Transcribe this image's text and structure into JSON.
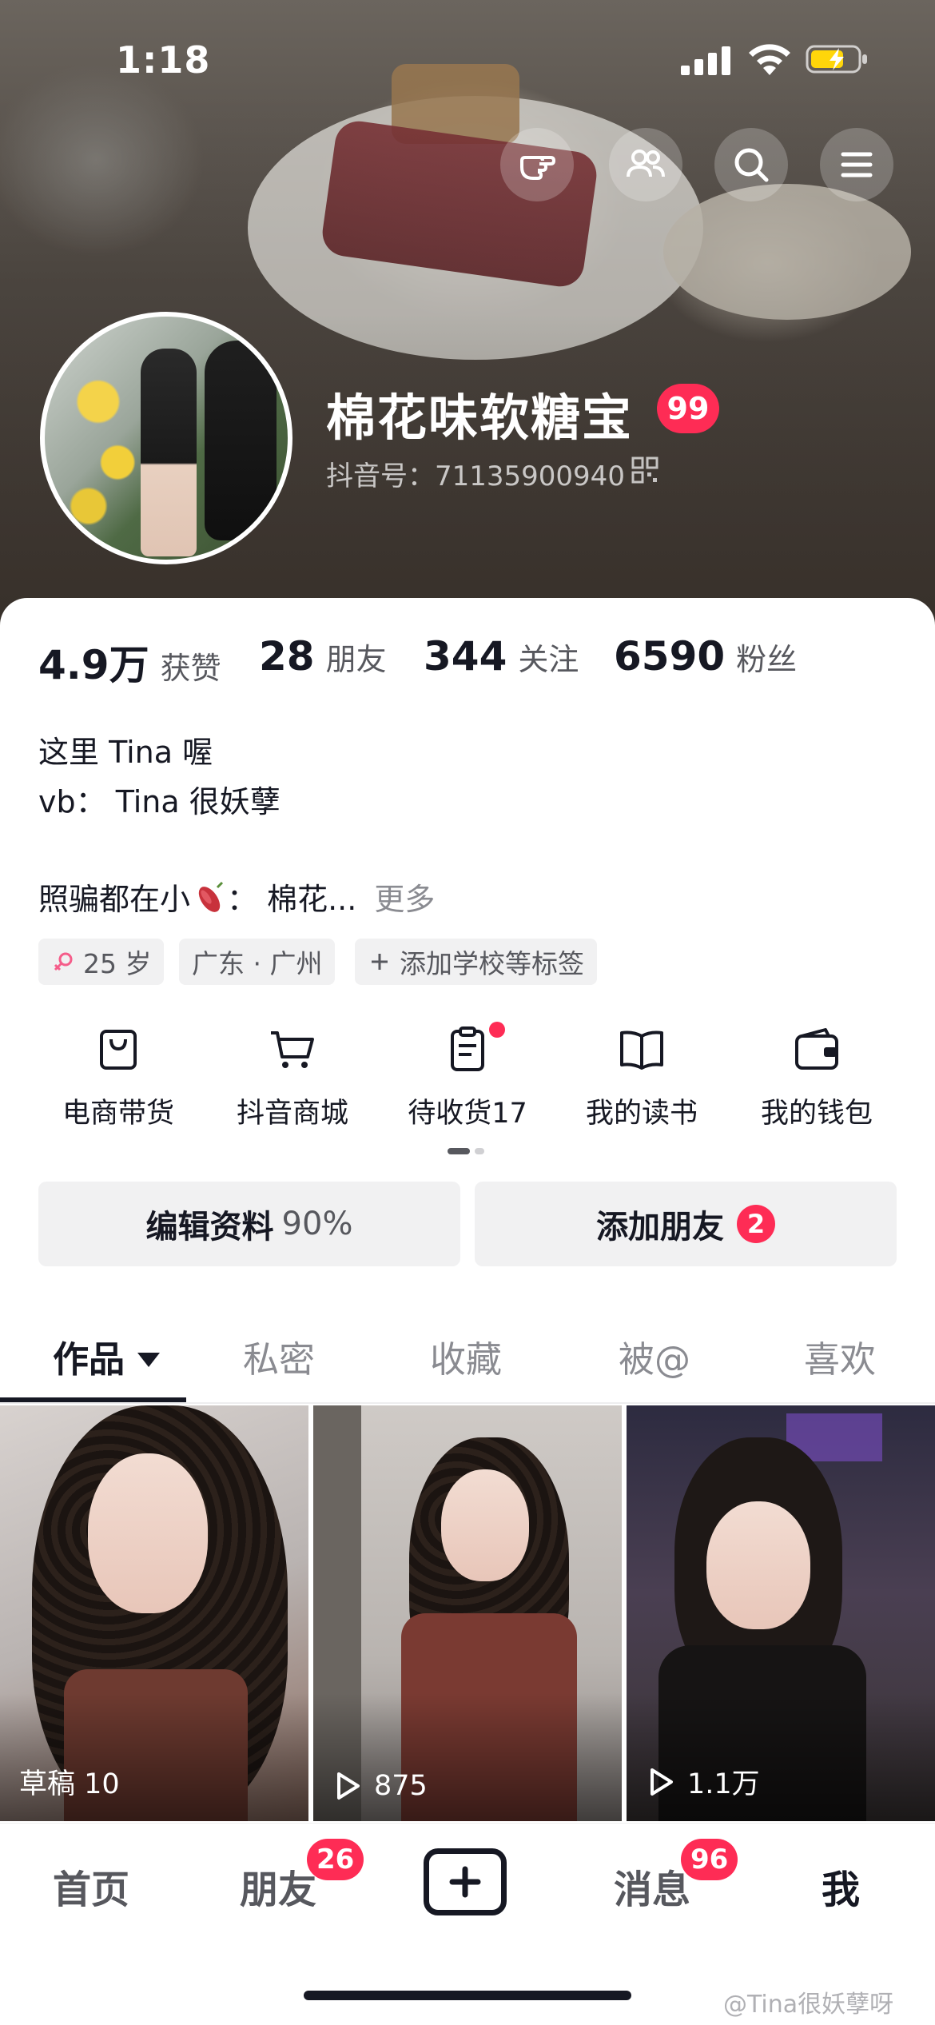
{
  "status_bar": {
    "time": "1:18"
  },
  "profile": {
    "nickname": "棉花味软糖宝",
    "level_badge": "99",
    "douyin_id": "抖音号：71135900940"
  },
  "stats": [
    {
      "value": "4.9万",
      "label": "获赞"
    },
    {
      "value": "28",
      "label": "朋友"
    },
    {
      "value": "344",
      "label": "关注"
    },
    {
      "value": "6590",
      "label": "粉丝"
    }
  ],
  "bio": {
    "line1": "这里 Tina 喔",
    "line2": "vb：  Tina 很妖孽",
    "line3_prefix": "照骗都在小",
    "line3_suffix": "：  棉花...",
    "more": "更多"
  },
  "tags": {
    "age": "25 岁",
    "location": "广东 · 广州",
    "add_school": "添加学校等标签"
  },
  "services": [
    {
      "label": "电商带货",
      "icon": "bag-icon"
    },
    {
      "label": "抖音商城",
      "icon": "cart-icon"
    },
    {
      "label": "待收货17",
      "icon": "clipboard-icon"
    },
    {
      "label": "我的读书",
      "icon": "book-icon"
    },
    {
      "label": "我的钱包",
      "icon": "wallet-icon"
    }
  ],
  "actions": {
    "edit_profile": "编辑资料",
    "edit_percent": "90%",
    "add_friend": "添加朋友",
    "add_friend_badge": "2"
  },
  "tabs": [
    "作品",
    "私密",
    "收藏",
    "被@",
    "喜欢"
  ],
  "videos": [
    {
      "caption": "草稿 10",
      "type": "draft"
    },
    {
      "caption": "875",
      "type": "play"
    },
    {
      "caption": "1.1万",
      "type": "play"
    }
  ],
  "nav": {
    "home": "首页",
    "friends": "朋友",
    "friends_badge": "26",
    "messages": "消息",
    "messages_badge": "96",
    "me": "我"
  },
  "watermark": "@Tina很妖孽呀",
  "colors": {
    "accent": "#fe2c55",
    "text_primary": "#161823",
    "text_secondary": "#57585e"
  }
}
